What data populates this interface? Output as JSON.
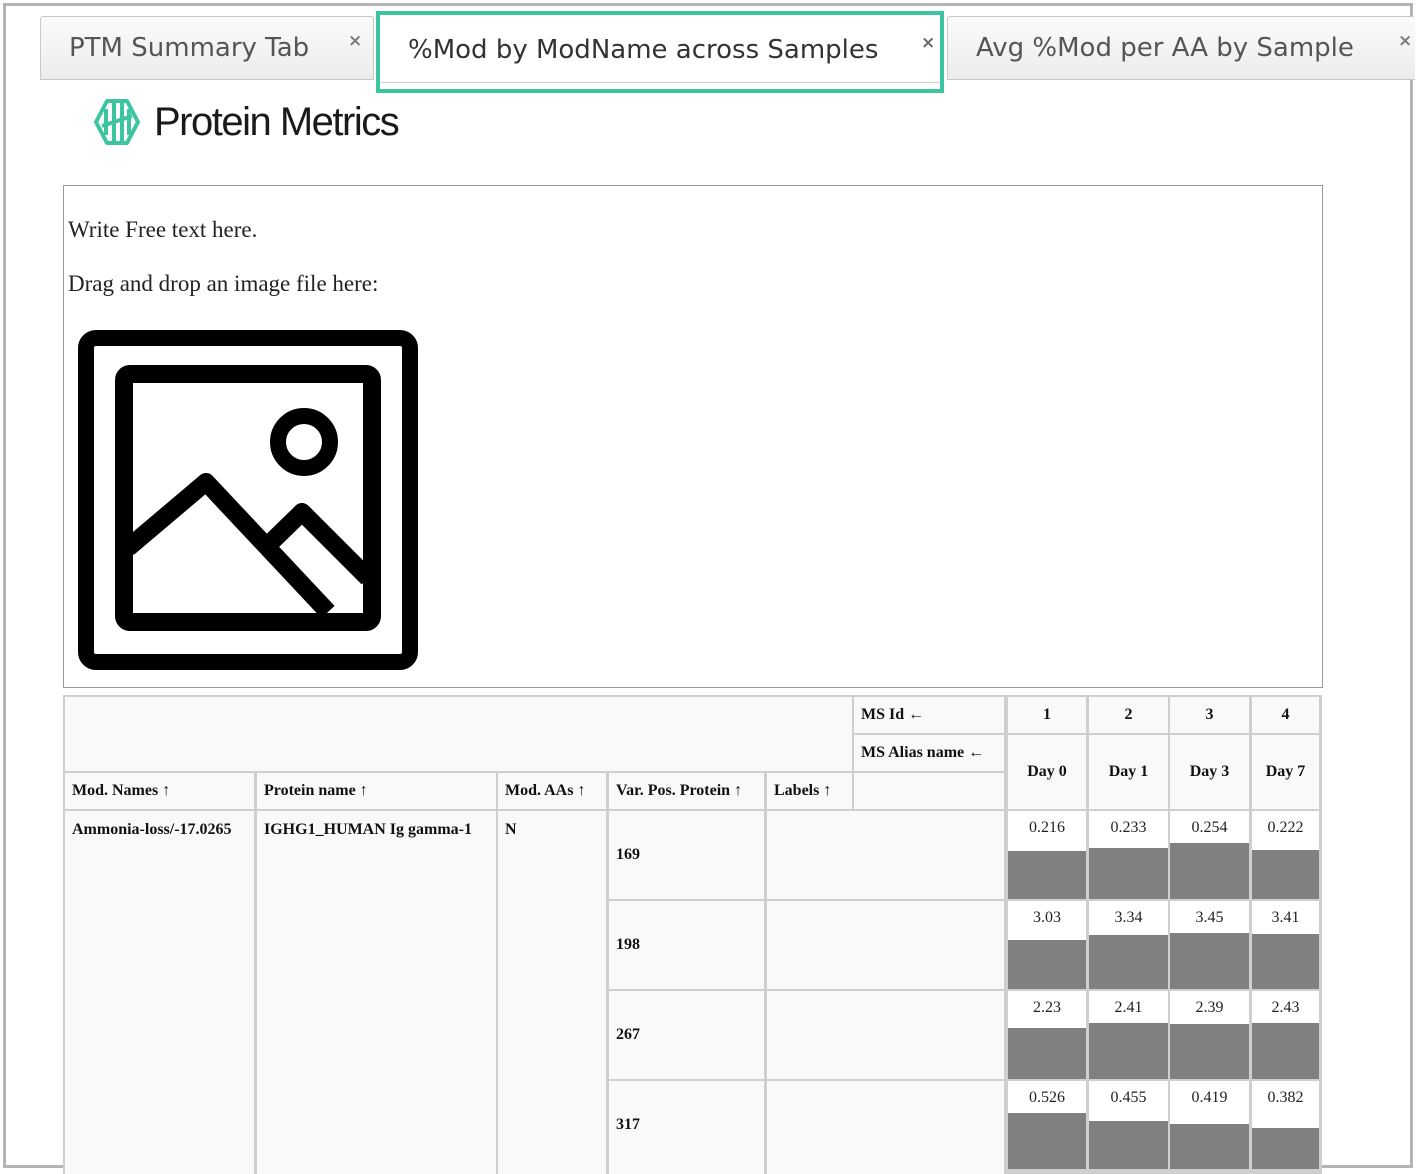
{
  "tabs": [
    {
      "label": "PTM Summary Tab",
      "close": "×"
    },
    {
      "label": "%Mod by ModName across Samples",
      "close": "×"
    },
    {
      "label": "Avg %Mod per AA by Sample",
      "close": "×"
    }
  ],
  "logo": {
    "text": "Protein Metrics",
    "color": "#3cc5a0"
  },
  "free_text": {
    "line1": "Write Free text here.",
    "line2": "Drag and drop an image file here:",
    "image_icon": "image-placeholder-icon"
  },
  "table": {
    "header": {
      "ms_id_label": "MS Id ←",
      "ms_alias_label": "MS Alias name ←",
      "columns": [
        "Mod. Names ↑",
        "Protein name ↑",
        "Mod. AAs ↑",
        "Var. Pos. Protein ↑",
        "Labels ↑"
      ],
      "samples": [
        {
          "id": "1",
          "alias": "Day 0"
        },
        {
          "id": "2",
          "alias": "Day 1"
        },
        {
          "id": "3",
          "alias": "Day 3"
        },
        {
          "id": "4",
          "alias": "Day 7"
        }
      ]
    },
    "group": {
      "mod_name": "Ammonia-loss/-17.0265",
      "protein_name": "IGHG1_HUMAN Ig gamma-1",
      "mod_aas": "N"
    },
    "rows": [
      {
        "position": "169",
        "labels": "",
        "values": [
          "0.216",
          "0.233",
          "0.254",
          "0.222"
        ]
      },
      {
        "position": "198",
        "labels": "",
        "values": [
          "3.03",
          "3.34",
          "3.45",
          "3.41"
        ]
      },
      {
        "position": "267",
        "labels": "",
        "values": [
          "2.23",
          "2.41",
          "2.39",
          "2.43"
        ]
      },
      {
        "position": "317",
        "labels": "",
        "values": [
          "0.526",
          "0.455",
          "0.419",
          "0.382"
        ]
      }
    ],
    "bar_color": "#808080"
  }
}
